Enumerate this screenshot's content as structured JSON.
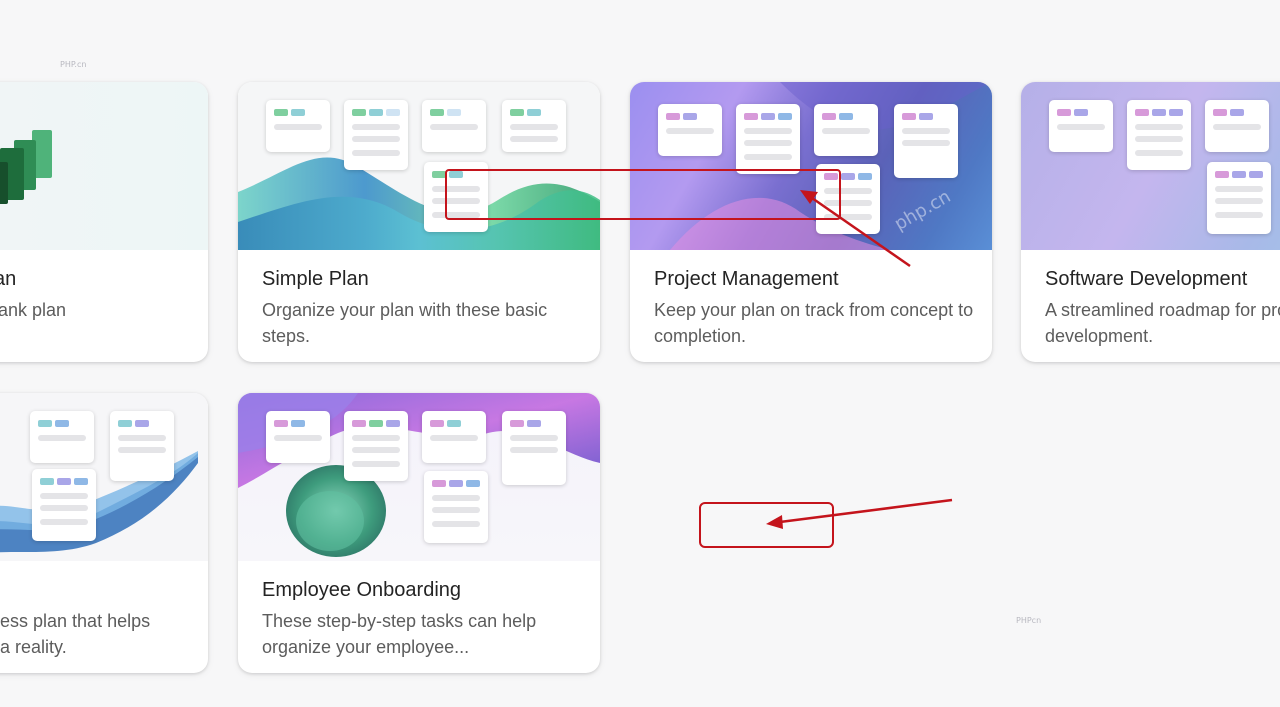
{
  "watermarks": {
    "top_left": "PHP.cn",
    "bottom_right": "PHPcn",
    "thumb_mark": "php.cn"
  },
  "cards": [
    {
      "id": "blank",
      "title": "Blank Plan",
      "title_visible": "an",
      "desc_visible": "lank plan"
    },
    {
      "id": "simple",
      "title": "Simple Plan",
      "desc": "Organize your plan with these basic steps."
    },
    {
      "id": "project",
      "title": "Project Management",
      "desc": "Keep your plan on track from concept to completion."
    },
    {
      "id": "software",
      "title": "Software Development",
      "desc": "A streamlined roadmap for product development."
    },
    {
      "id": "business",
      "desc_visible": "ess plan that helps\na reality."
    },
    {
      "id": "onboarding",
      "title": "Employee Onboarding",
      "desc": "These step-by-step tasks can help organize your employee..."
    }
  ],
  "colors": {
    "annotation_red": "#c4141c",
    "chip_green": "#7fcf9f",
    "chip_teal": "#8fcfd6",
    "chip_pink": "#d79ad9",
    "chip_lavender": "#a9a6e8",
    "chip_blue": "#8fb8e6"
  }
}
